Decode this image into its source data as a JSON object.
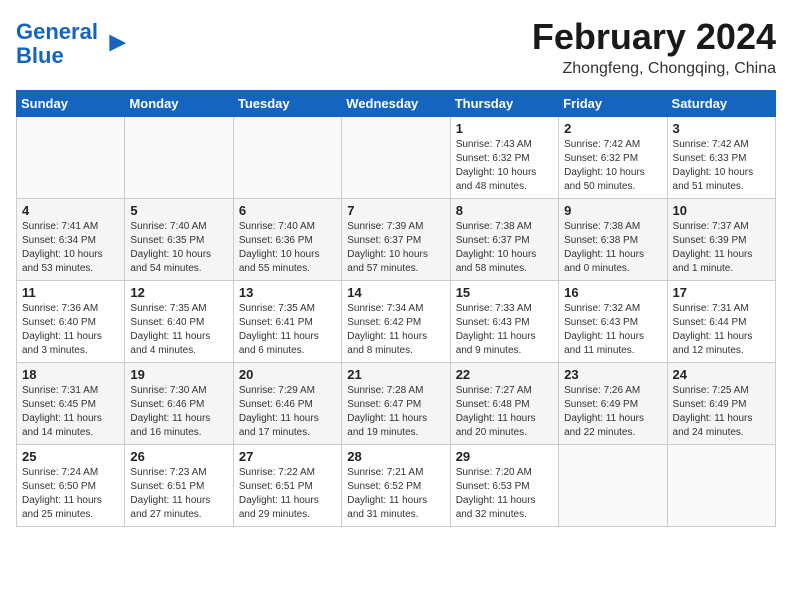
{
  "header": {
    "logo_line1": "General",
    "logo_line2": "Blue",
    "title": "February 2024",
    "subtitle": "Zhongfeng, Chongqing, China"
  },
  "columns": [
    "Sunday",
    "Monday",
    "Tuesday",
    "Wednesday",
    "Thursday",
    "Friday",
    "Saturday"
  ],
  "weeks": [
    [
      {
        "day": "",
        "info": ""
      },
      {
        "day": "",
        "info": ""
      },
      {
        "day": "",
        "info": ""
      },
      {
        "day": "",
        "info": ""
      },
      {
        "day": "1",
        "info": "Sunrise: 7:43 AM\nSunset: 6:32 PM\nDaylight: 10 hours\nand 48 minutes."
      },
      {
        "day": "2",
        "info": "Sunrise: 7:42 AM\nSunset: 6:32 PM\nDaylight: 10 hours\nand 50 minutes."
      },
      {
        "day": "3",
        "info": "Sunrise: 7:42 AM\nSunset: 6:33 PM\nDaylight: 10 hours\nand 51 minutes."
      }
    ],
    [
      {
        "day": "4",
        "info": "Sunrise: 7:41 AM\nSunset: 6:34 PM\nDaylight: 10 hours\nand 53 minutes."
      },
      {
        "day": "5",
        "info": "Sunrise: 7:40 AM\nSunset: 6:35 PM\nDaylight: 10 hours\nand 54 minutes."
      },
      {
        "day": "6",
        "info": "Sunrise: 7:40 AM\nSunset: 6:36 PM\nDaylight: 10 hours\nand 55 minutes."
      },
      {
        "day": "7",
        "info": "Sunrise: 7:39 AM\nSunset: 6:37 PM\nDaylight: 10 hours\nand 57 minutes."
      },
      {
        "day": "8",
        "info": "Sunrise: 7:38 AM\nSunset: 6:37 PM\nDaylight: 10 hours\nand 58 minutes."
      },
      {
        "day": "9",
        "info": "Sunrise: 7:38 AM\nSunset: 6:38 PM\nDaylight: 11 hours\nand 0 minutes."
      },
      {
        "day": "10",
        "info": "Sunrise: 7:37 AM\nSunset: 6:39 PM\nDaylight: 11 hours\nand 1 minute."
      }
    ],
    [
      {
        "day": "11",
        "info": "Sunrise: 7:36 AM\nSunset: 6:40 PM\nDaylight: 11 hours\nand 3 minutes."
      },
      {
        "day": "12",
        "info": "Sunrise: 7:35 AM\nSunset: 6:40 PM\nDaylight: 11 hours\nand 4 minutes."
      },
      {
        "day": "13",
        "info": "Sunrise: 7:35 AM\nSunset: 6:41 PM\nDaylight: 11 hours\nand 6 minutes."
      },
      {
        "day": "14",
        "info": "Sunrise: 7:34 AM\nSunset: 6:42 PM\nDaylight: 11 hours\nand 8 minutes."
      },
      {
        "day": "15",
        "info": "Sunrise: 7:33 AM\nSunset: 6:43 PM\nDaylight: 11 hours\nand 9 minutes."
      },
      {
        "day": "16",
        "info": "Sunrise: 7:32 AM\nSunset: 6:43 PM\nDaylight: 11 hours\nand 11 minutes."
      },
      {
        "day": "17",
        "info": "Sunrise: 7:31 AM\nSunset: 6:44 PM\nDaylight: 11 hours\nand 12 minutes."
      }
    ],
    [
      {
        "day": "18",
        "info": "Sunrise: 7:31 AM\nSunset: 6:45 PM\nDaylight: 11 hours\nand 14 minutes."
      },
      {
        "day": "19",
        "info": "Sunrise: 7:30 AM\nSunset: 6:46 PM\nDaylight: 11 hours\nand 16 minutes."
      },
      {
        "day": "20",
        "info": "Sunrise: 7:29 AM\nSunset: 6:46 PM\nDaylight: 11 hours\nand 17 minutes."
      },
      {
        "day": "21",
        "info": "Sunrise: 7:28 AM\nSunset: 6:47 PM\nDaylight: 11 hours\nand 19 minutes."
      },
      {
        "day": "22",
        "info": "Sunrise: 7:27 AM\nSunset: 6:48 PM\nDaylight: 11 hours\nand 20 minutes."
      },
      {
        "day": "23",
        "info": "Sunrise: 7:26 AM\nSunset: 6:49 PM\nDaylight: 11 hours\nand 22 minutes."
      },
      {
        "day": "24",
        "info": "Sunrise: 7:25 AM\nSunset: 6:49 PM\nDaylight: 11 hours\nand 24 minutes."
      }
    ],
    [
      {
        "day": "25",
        "info": "Sunrise: 7:24 AM\nSunset: 6:50 PM\nDaylight: 11 hours\nand 25 minutes."
      },
      {
        "day": "26",
        "info": "Sunrise: 7:23 AM\nSunset: 6:51 PM\nDaylight: 11 hours\nand 27 minutes."
      },
      {
        "day": "27",
        "info": "Sunrise: 7:22 AM\nSunset: 6:51 PM\nDaylight: 11 hours\nand 29 minutes."
      },
      {
        "day": "28",
        "info": "Sunrise: 7:21 AM\nSunset: 6:52 PM\nDaylight: 11 hours\nand 31 minutes."
      },
      {
        "day": "29",
        "info": "Sunrise: 7:20 AM\nSunset: 6:53 PM\nDaylight: 11 hours\nand 32 minutes."
      },
      {
        "day": "",
        "info": ""
      },
      {
        "day": "",
        "info": ""
      }
    ]
  ]
}
